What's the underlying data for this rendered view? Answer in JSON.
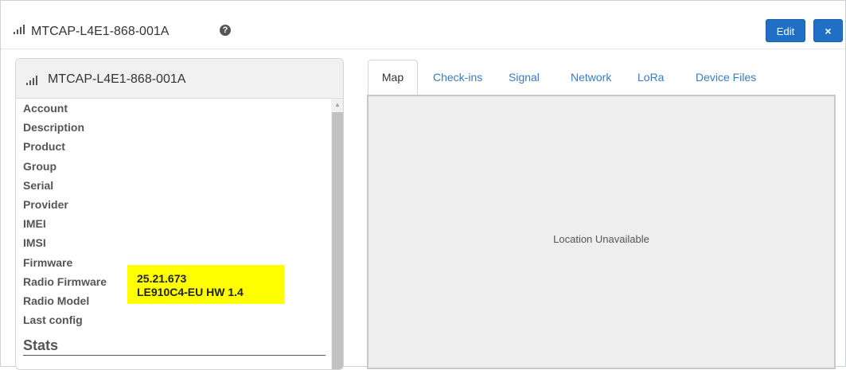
{
  "window": {
    "title": "MTCAP-L4E1-868-001A",
    "help_icon": "?",
    "edit_label": "Edit",
    "close_label": "×"
  },
  "device_panel": {
    "title": "MTCAP-L4E1-868-001A",
    "fields": [
      {
        "label": "Account"
      },
      {
        "label": "Description"
      },
      {
        "label": "Product"
      },
      {
        "label": "Group"
      },
      {
        "label": "Serial"
      },
      {
        "label": "Provider"
      },
      {
        "label": "IMEI"
      },
      {
        "label": "IMSI"
      },
      {
        "label": "Firmware"
      },
      {
        "label": "Radio Firmware",
        "value": "25.21.673"
      },
      {
        "label": "Radio Model",
        "value": "LE910C4-EU HW 1.4"
      },
      {
        "label": "Last config"
      }
    ],
    "stats_heading": "Stats"
  },
  "tabs": [
    {
      "label": "Map",
      "active": true
    },
    {
      "label": "Check-ins",
      "active": false
    },
    {
      "label": "Signal",
      "active": false
    },
    {
      "label": "Network",
      "active": false
    },
    {
      "label": "LoRa",
      "active": false
    },
    {
      "label": "Device Files",
      "active": false
    }
  ],
  "map": {
    "message": "Location Unavailable"
  },
  "icons": {
    "signal": "signal-bars-icon",
    "help": "question-circle-icon",
    "close": "close-icon"
  },
  "colors": {
    "primary_button": "#1f6fc5",
    "tab_link": "#3a7bbf",
    "highlight": "#ffff00",
    "map_background": "#eeeeee"
  }
}
